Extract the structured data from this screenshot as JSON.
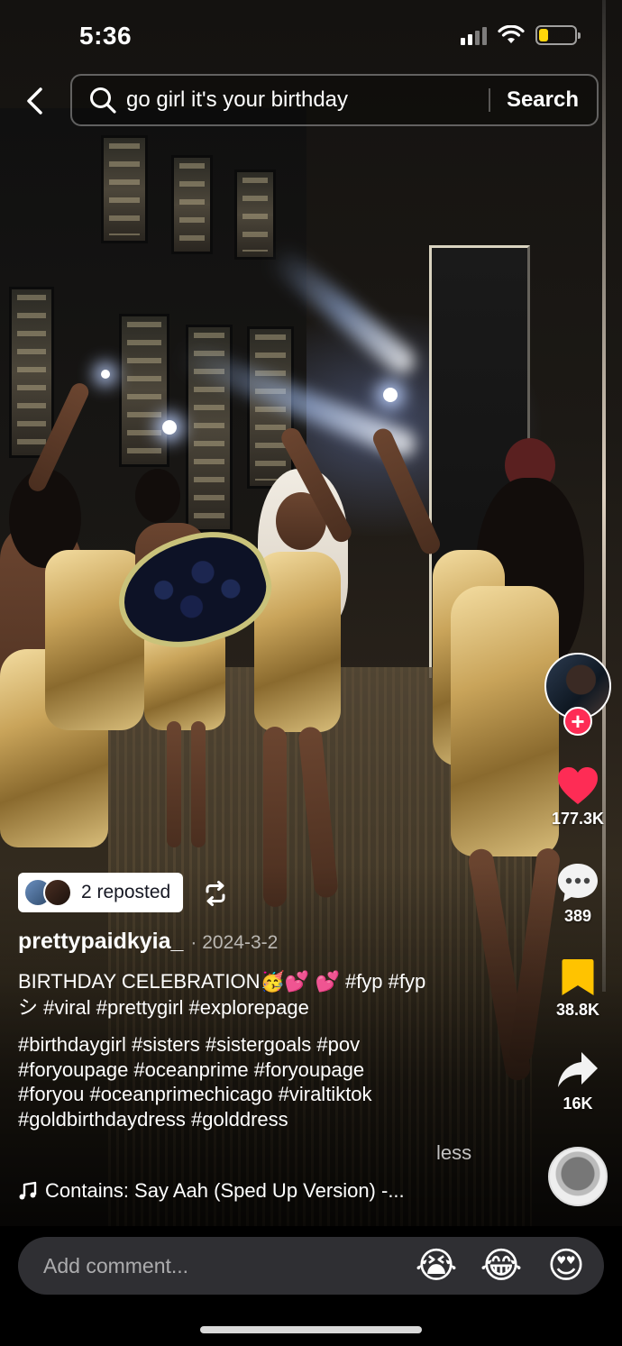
{
  "status_bar": {
    "time": "5:36",
    "battery_level": 0.25
  },
  "search": {
    "query": "go girl it's your birthday",
    "button_label": "Search"
  },
  "creator": {
    "follow_symbol": "+"
  },
  "actions": {
    "likes": "177.3K",
    "comments": "389",
    "saves": "38.8K",
    "shares": "16K"
  },
  "repost": {
    "label": "2 reposted"
  },
  "post": {
    "username": "prettypaidkyia_",
    "date": "· 2024-3-2",
    "caption_line1": "BIRTHDAY CELEBRATION🥳💕 💕 #fyp  #fyp",
    "caption_line2": "シ #viral #prettygirl #explorepage",
    "hashtags": [
      "#birthdaygirl #sisters #sistergoals #pov",
      "#foryoupage #oceanprime #foryoupage",
      "#foryou #oceanprimechicago #viraltiktok",
      "#goldbirthdaydress #golddress"
    ],
    "less_label": "less",
    "music": "Contains: Say Aah (Sped Up Version) -..."
  },
  "comment_bar": {
    "placeholder": "Add comment...",
    "emojis": [
      "😭",
      "😂",
      "😍"
    ]
  },
  "colors": {
    "like_red": "#fe2c55",
    "save_yellow": "#ffc300",
    "battery_yellow": "#ffd60a"
  }
}
